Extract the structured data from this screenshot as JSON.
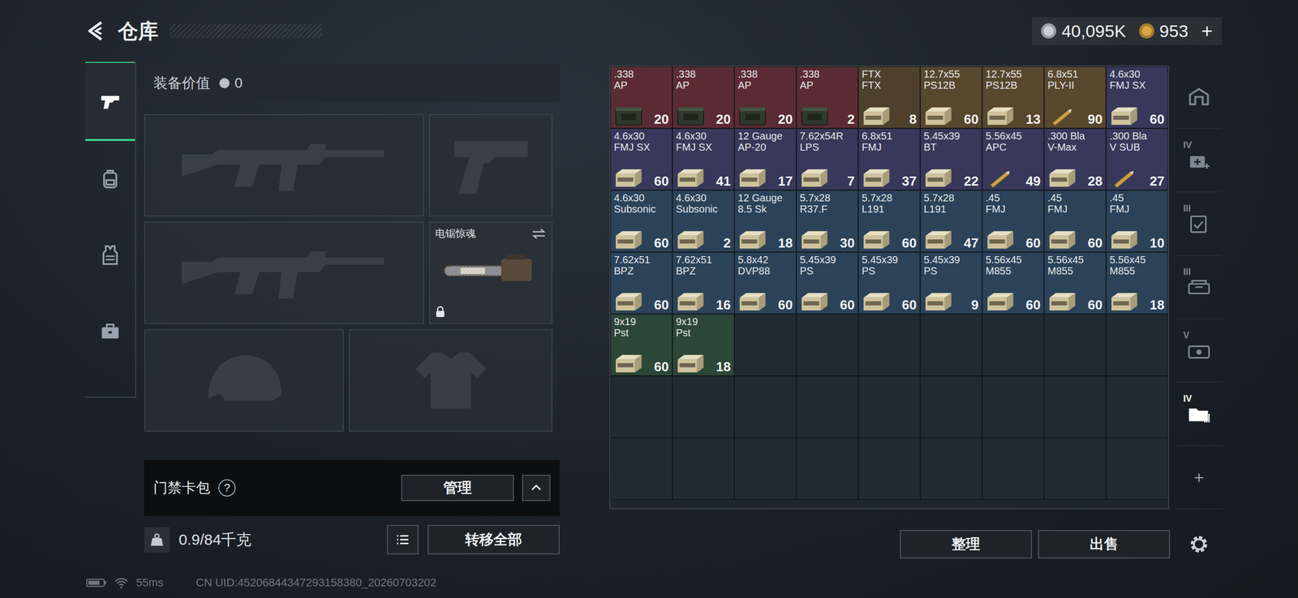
{
  "header": {
    "title": "仓库",
    "currencies": [
      {
        "amount": "40,095K",
        "color": "#c9cfd6"
      },
      {
        "amount": "953",
        "color": "#d9a441"
      }
    ],
    "add": "+"
  },
  "rail": [
    {
      "kind": "gun",
      "selected": true
    },
    {
      "kind": "backpack",
      "selected": false
    },
    {
      "kind": "vest",
      "selected": false
    },
    {
      "kind": "toolbox",
      "selected": false
    }
  ],
  "equipment": {
    "label": "装备价值",
    "value": "0",
    "slots": [
      {
        "kind": "rifle",
        "name": "",
        "filled": false,
        "locked": false,
        "swap": false
      },
      {
        "kind": "pistol",
        "name": "",
        "filled": false,
        "locked": false,
        "swap": false
      },
      {
        "kind": "rifle",
        "name": "",
        "filled": false,
        "locked": false,
        "swap": false
      },
      {
        "kind": "melee",
        "name": "电锯惊魂",
        "filled": true,
        "locked": true,
        "swap": true
      },
      {
        "kind": "helmet",
        "name": "",
        "filled": false,
        "locked": false,
        "swap": false
      },
      {
        "kind": "armor",
        "name": "",
        "filled": false,
        "locked": false,
        "swap": false
      }
    ]
  },
  "keycard": {
    "label": "门禁卡包",
    "help": "?",
    "button": "管理",
    "expanded": false
  },
  "weight": {
    "text": "0.9/84千克"
  },
  "transfer": "转移全部",
  "stash": {
    "items": [
      {
        "line1": ".338",
        "line2": "AP",
        "count": "20",
        "color": "#5b2b33",
        "kind": "can"
      },
      {
        "line1": ".338",
        "line2": "AP",
        "count": "20",
        "color": "#5b2b33",
        "kind": "can"
      },
      {
        "line1": ".338",
        "line2": "AP",
        "count": "20",
        "color": "#5b2b33",
        "kind": "can"
      },
      {
        "line1": ".338",
        "line2": "AP",
        "count": "2",
        "color": "#5b2b33",
        "kind": "can"
      },
      {
        "line1": "FTX",
        "line2": "FTX",
        "count": "8",
        "color": "#4f402d",
        "kind": "box"
      },
      {
        "line1": "12.7x55",
        "line2": "PS12B",
        "count": "60",
        "color": "#57472c",
        "kind": "box"
      },
      {
        "line1": "12.7x55",
        "line2": "PS12B",
        "count": "13",
        "color": "#57472c",
        "kind": "box"
      },
      {
        "line1": "6.8x51",
        "line2": "PLY-II",
        "count": "90",
        "color": "#57472c",
        "kind": "round"
      },
      {
        "line1": "4.6x30",
        "line2": "FMJ SX",
        "count": "60",
        "color": "#37385a",
        "kind": "box"
      },
      {
        "line1": "4.6x30",
        "line2": "FMJ SX",
        "count": "60",
        "color": "#37385a",
        "kind": "box"
      },
      {
        "line1": "4.6x30",
        "line2": "FMJ SX",
        "count": "41",
        "color": "#37385a",
        "kind": "box"
      },
      {
        "line1": "12 Gauge",
        "line2": "AP-20",
        "count": "17",
        "color": "#37385a",
        "kind": "box"
      },
      {
        "line1": "7.62x54R",
        "line2": "LPS",
        "count": "7",
        "color": "#37385a",
        "kind": "box"
      },
      {
        "line1": "6.8x51",
        "line2": "FMJ",
        "count": "37",
        "color": "#37385a",
        "kind": "box"
      },
      {
        "line1": "5.45x39",
        "line2": "BT",
        "count": "22",
        "color": "#37385a",
        "kind": "box"
      },
      {
        "line1": "5.56x45",
        "line2": "APC",
        "count": "49",
        "color": "#37385a",
        "kind": "round"
      },
      {
        "line1": ".300 Bla",
        "line2": "V-Max",
        "count": "28",
        "color": "#37385a",
        "kind": "box"
      },
      {
        "line1": ".300 Bla",
        "line2": "V SUB",
        "count": "27",
        "color": "#37385a",
        "kind": "round"
      },
      {
        "line1": "4.6x30",
        "line2": "Subsonic",
        "count": "60",
        "color": "#2b4259",
        "kind": "box"
      },
      {
        "line1": "4.6x30",
        "line2": "Subsonic",
        "count": "2",
        "color": "#2b4259",
        "kind": "box"
      },
      {
        "line1": "12 Gauge",
        "line2": "8.5 Sk",
        "count": "18",
        "color": "#2b4259",
        "kind": "box"
      },
      {
        "line1": "5.7x28",
        "line2": "R37.F",
        "count": "30",
        "color": "#2b4259",
        "kind": "box"
      },
      {
        "line1": "5.7x28",
        "line2": "L191",
        "count": "60",
        "color": "#2b4259",
        "kind": "box"
      },
      {
        "line1": "5.7x28",
        "line2": "L191",
        "count": "47",
        "color": "#2b4259",
        "kind": "box"
      },
      {
        "line1": ".45",
        "line2": "FMJ",
        "count": "60",
        "color": "#2b4259",
        "kind": "box"
      },
      {
        "line1": ".45",
        "line2": "FMJ",
        "count": "60",
        "color": "#2b4259",
        "kind": "box"
      },
      {
        "line1": ".45",
        "line2": "FMJ",
        "count": "10",
        "color": "#2b4259",
        "kind": "box"
      },
      {
        "line1": "7.62x51",
        "line2": "BPZ",
        "count": "60",
        "color": "#2b4259",
        "kind": "box"
      },
      {
        "line1": "7.62x51",
        "line2": "BPZ",
        "count": "16",
        "color": "#2b4259",
        "kind": "box"
      },
      {
        "line1": "5.8x42",
        "line2": "DVP88",
        "count": "60",
        "color": "#2b4259",
        "kind": "box"
      },
      {
        "line1": "5.45x39",
        "line2": "PS",
        "count": "60",
        "color": "#2b4259",
        "kind": "box"
      },
      {
        "line1": "5.45x39",
        "line2": "PS",
        "count": "60",
        "color": "#2b4259",
        "kind": "box"
      },
      {
        "line1": "5.45x39",
        "line2": "PS",
        "count": "9",
        "color": "#2b4259",
        "kind": "box"
      },
      {
        "line1": "5.56x45",
        "line2": "M855",
        "count": "60",
        "color": "#2b4259",
        "kind": "box"
      },
      {
        "line1": "5.56x45",
        "line2": "M855",
        "count": "60",
        "color": "#2b4259",
        "kind": "box"
      },
      {
        "line1": "5.56x45",
        "line2": "M855",
        "count": "18",
        "color": "#2b4259",
        "kind": "box"
      },
      {
        "line1": "9x19",
        "line2": "Pst",
        "count": "60",
        "color": "#2c4637",
        "kind": "box"
      },
      {
        "line1": "9x19",
        "line2": "Pst",
        "count": "18",
        "color": "#2c4637",
        "kind": "box"
      }
    ]
  },
  "actions": [
    "整理",
    "出售"
  ],
  "categories": [
    {
      "kind": "home",
      "label": "",
      "selected": false
    },
    {
      "kind": "medical",
      "label": "IV",
      "selected": false
    },
    {
      "kind": "armor",
      "label": "III",
      "selected": false
    },
    {
      "kind": "rig",
      "label": "III",
      "selected": false
    },
    {
      "kind": "case",
      "label": "V",
      "selected": false
    },
    {
      "kind": "folder",
      "label": "IV",
      "selected": true
    },
    {
      "kind": "add",
      "label": "+",
      "selected": false
    }
  ],
  "status": {
    "ping": "55ms",
    "uid": "CN UID:45206844347293158380_20260703202"
  }
}
